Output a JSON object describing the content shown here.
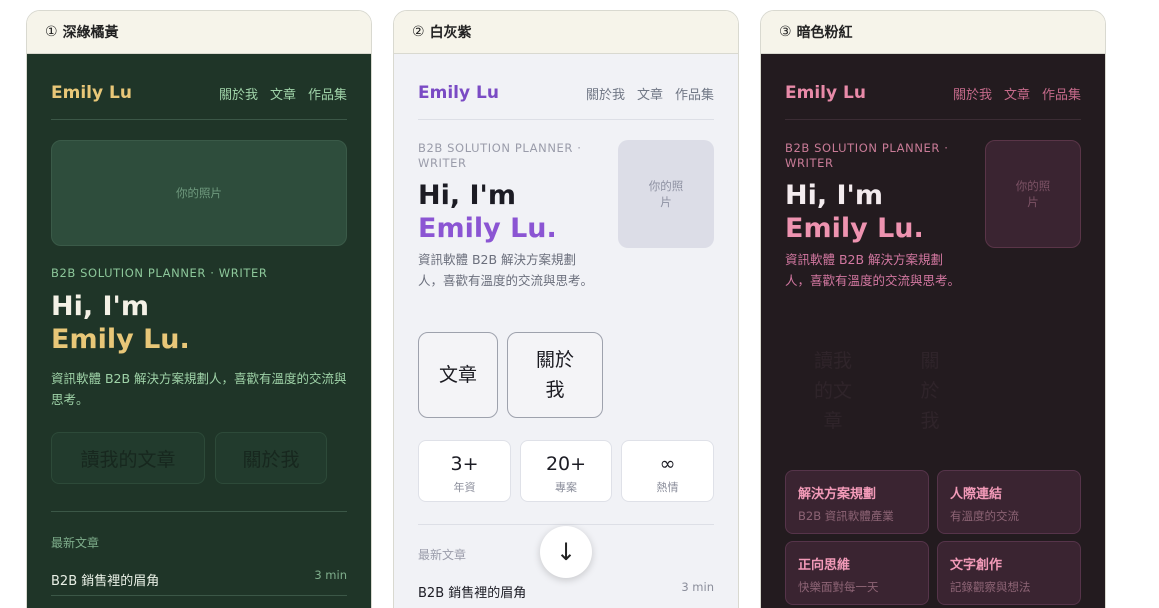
{
  "panels": [
    {
      "header": {
        "num": "①",
        "title": "深綠橘黃"
      },
      "brand": "Emily Lu",
      "nav": [
        "關於我",
        "文章",
        "作品集"
      ],
      "photo": "你的照片",
      "eyebrow": "B2B SOLUTION PLANNER · WRITER",
      "hi": "Hi, I'm",
      "name": "Emily Lu.",
      "desc": "資訊軟體 B2B 解決方案規劃人，喜歡有溫度的交流與思考。",
      "buttons": [
        "讀我的文章",
        "關於我"
      ],
      "latest": "最新文章",
      "posts": [
        {
          "title": "B2B 銷售裡的眉角",
          "time": "3 min"
        }
      ]
    },
    {
      "header": {
        "num": "②",
        "title": "白灰紫"
      },
      "brand": "Emily Lu",
      "nav": [
        "關於我",
        "文章",
        "作品集"
      ],
      "eyebrow": "B2B SOLUTION PLANNER · WRITER",
      "hi": "Hi, I'm",
      "name": "Emily Lu.",
      "desc": "資訊軟體 B2B 解決方案規劃人，喜歡有溫度的交流與思考。",
      "photo": "你的照片",
      "buttons": [
        "文章",
        "關於我"
      ],
      "stats": [
        {
          "value": "3+",
          "label": "年資"
        },
        {
          "value": "20+",
          "label": "專案"
        },
        {
          "value": "∞",
          "label": "熱情"
        }
      ],
      "latest": "最新文章",
      "posts": [
        {
          "title": "B2B 銷售裡的眉角",
          "time": "3 min"
        }
      ],
      "scroll_icon": "↓"
    },
    {
      "header": {
        "num": "③",
        "title": "暗色粉紅"
      },
      "brand": "Emily Lu",
      "nav": [
        "關於我",
        "文章",
        "作品集"
      ],
      "eyebrow": "B2B SOLUTION PLANNER · WRITER",
      "hi": "Hi, I'm",
      "name": "Emily Lu.",
      "desc": "資訊軟體 B2B 解決方案規劃人，喜歡有溫度的交流與思考。",
      "photo": "你的照片",
      "buttons": [
        "讀我的文章",
        "關於我"
      ],
      "cards": [
        {
          "title": "解決方案規劃",
          "sub": "B2B 資訊軟體產業"
        },
        {
          "title": "人際連結",
          "sub": "有溫度的交流"
        },
        {
          "title": "正向思維",
          "sub": "快樂面對每一天"
        },
        {
          "title": "文字創作",
          "sub": "記錄觀察與想法"
        }
      ]
    }
  ]
}
